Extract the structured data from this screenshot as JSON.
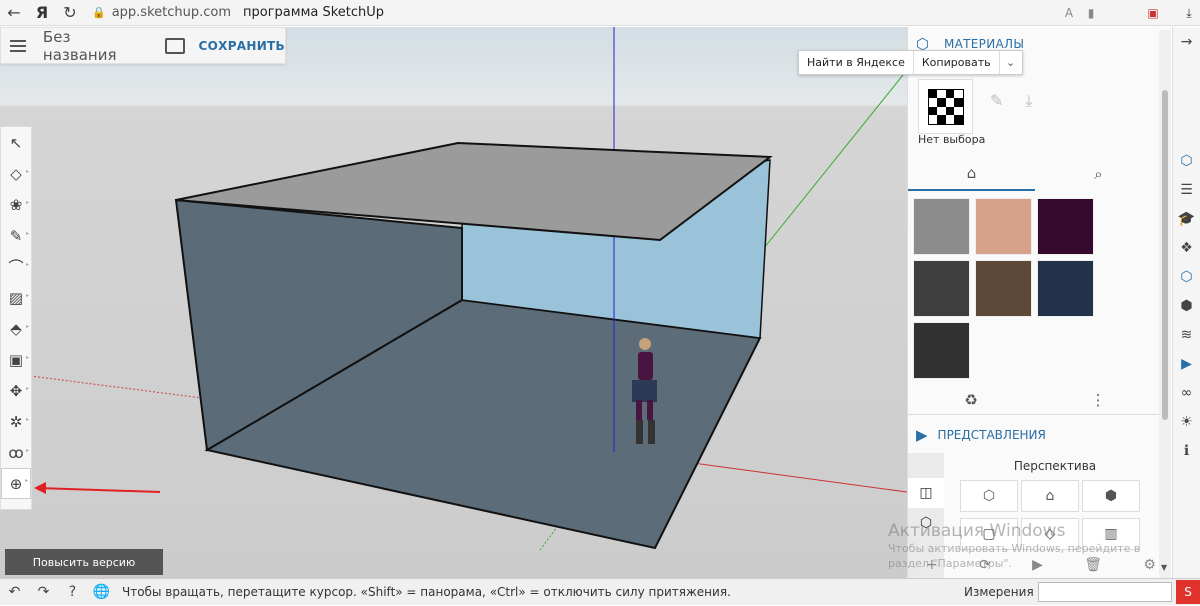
{
  "browser": {
    "back_icon": "back-arrow-icon",
    "logo_text": "Я",
    "url_domain": "app.sketchup.com",
    "page_title": "программа SketchUp"
  },
  "header": {
    "doc_title": "Без названия",
    "save_label": "СОХРАНИТЬ"
  },
  "context_popup": {
    "find_label": "Найти в Яндексе",
    "copy_label": "Копировать"
  },
  "left_toolbar": {
    "tools": [
      "select",
      "eraser",
      "paint",
      "pencil",
      "arc",
      "rectangle",
      "push-pull",
      "offset",
      "move",
      "rotate",
      "footprint",
      "orbit"
    ],
    "active_tool": "orbit"
  },
  "upgrade": {
    "label": "Повысить версию"
  },
  "materials": {
    "title": "МАТЕРИАЛЫ",
    "selection_text": "Нет выбора",
    "swatches": [
      "#8c8c8c",
      "#d6a38a",
      "#360a2e",
      "#3f3f3f",
      "#5e4838",
      "#22324a",
      "#323232"
    ]
  },
  "views": {
    "title": "ПРЕДСТАВЛЕНИЯ",
    "group_label": "Перспектива"
  },
  "watermark": {
    "line1": "Активация Windows",
    "line2": "Чтобы активировать Windows, перейдите в",
    "line3": "раздел \"Параметры\"."
  },
  "status": {
    "hint": "Чтобы вращать, перетащите курсор. «Shift» = панорама, «Ctrl» = отключить силу притяжения.",
    "measure_label": "Измерения",
    "measure_value": ""
  },
  "colors": {
    "accent": "#2a6ea6",
    "wall_front": "#5b6b77",
    "wall_back": "#9ac2d8",
    "top": "#9b9b9b",
    "floor": "#5c6c78"
  }
}
